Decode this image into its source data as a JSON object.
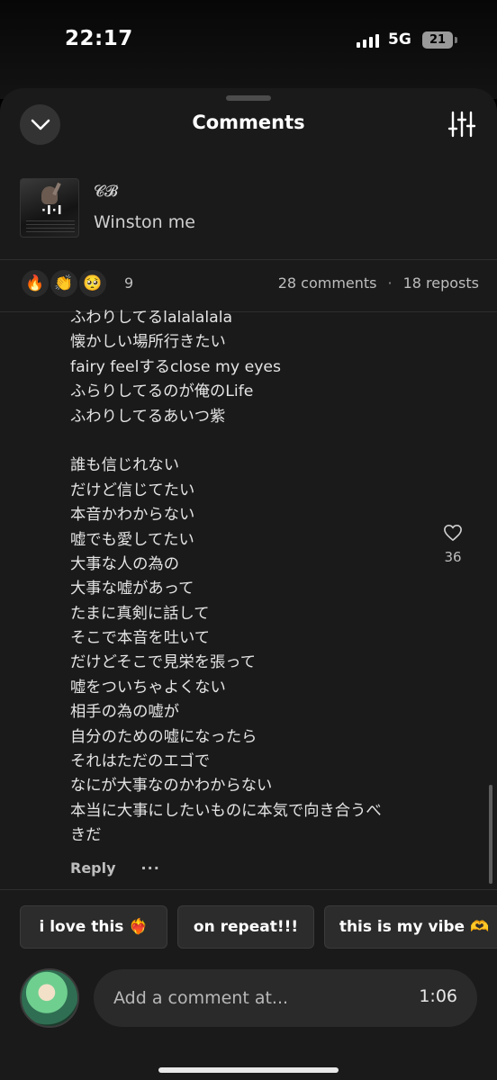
{
  "status_bar": {
    "time": "22:17",
    "network": "5G",
    "battery": "21"
  },
  "header": {
    "title": "Comments",
    "collapse_icon": "chevron-down-icon",
    "filter_icon": "sliders-icon"
  },
  "track": {
    "artist": "𝓒𝓑",
    "title": "Winston me"
  },
  "stats": {
    "reactions": [
      "🔥",
      "👏",
      "🥺"
    ],
    "reaction_count": "9",
    "comments": "28 comments",
    "separator": "·",
    "reposts": "18 reposts"
  },
  "comment": {
    "lines": [
      "ふわりしてるlalalalala",
      "懐かしい場所行きたい",
      "fairy feelするclose my eyes",
      "ふらりしてるのが俺のLife",
      "ふわりしてるあいつ紫",
      "",
      "誰も信じれない",
      "だけど信じてたい",
      "本音かわからない",
      "嘘でも愛してたい",
      "大事な人の為の",
      "大事な嘘があって",
      "たまに真剣に話して",
      "そこで本音を吐いて",
      "だけどそこで見栄を張って",
      "嘘をついちゃよくない",
      "相手の為の嘘が",
      "自分のための嘘になったら",
      "それはただのエゴで",
      "なにが大事なのかわからない",
      "本当に大事にしたいものに本気で向き合うべ",
      "きだ"
    ],
    "like_count": "36",
    "reply_label": "Reply",
    "more_label": "···"
  },
  "suggestions": [
    "i love this ❤️‍🔥",
    "on repeat!!!",
    "this is my vibe 🫶"
  ],
  "composer": {
    "placeholder": "Add a comment at...",
    "timestamp": "1:06"
  }
}
